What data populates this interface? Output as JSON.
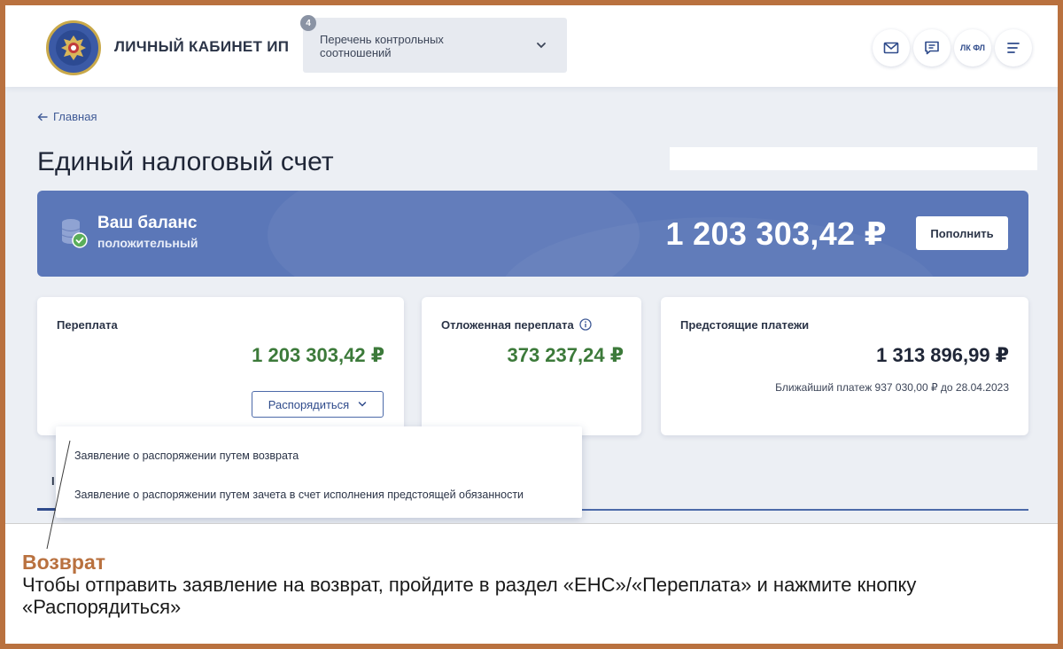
{
  "header": {
    "brand": "ЛИЧНЫЙ КАБИНЕТ ИП",
    "dropdown": {
      "badge": "4",
      "label": "Перечень контрольных соотношений"
    },
    "buttons": {
      "fl_label": "ЛК ФЛ"
    }
  },
  "breadcrumb": {
    "back_label": "Главная"
  },
  "page_title": "Единый налоговый счет",
  "balance": {
    "title": "Ваш баланс",
    "status": "положительный",
    "amount": "1 203 303,42 ₽",
    "topup_label": "Пополнить"
  },
  "cards": {
    "overpayment": {
      "title": "Переплата",
      "amount": "1 203 303,42 ₽",
      "action_label": "Распорядиться"
    },
    "deferred": {
      "title": "Отложенная переплата",
      "amount": "373 237,24 ₽"
    },
    "upcoming": {
      "title": "Предстоящие платежи",
      "amount": "1 313 896,99 ₽",
      "note": "Ближайший платеж 937 030,00 ₽ до 28.04.2023"
    }
  },
  "menu": {
    "items": [
      {
        "label": "Заявление о распоряжении путем возврата"
      },
      {
        "label": "Заявление о распоряжении путем зачета в счет исполнения предстоящей обязанности"
      }
    ]
  },
  "tab_fragment": "I",
  "caption": {
    "heading": "Возврат",
    "text": "Чтобы отправить заявление на возврат, пройдите в раздел «ЕНС»/«Переплата» и нажмите кнопку «Распорядиться»"
  },
  "colors": {
    "accent": "#5b77b8",
    "positive": "#3c7a3a",
    "frame": "#b9713f"
  }
}
